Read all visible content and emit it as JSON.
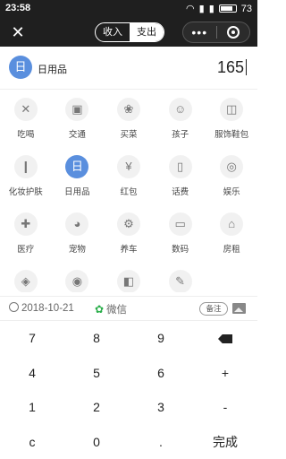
{
  "status_bar": {
    "time": "23:58",
    "battery": "73"
  },
  "top_bar": {
    "close_glyph": "✕",
    "tab_income": "收入",
    "tab_expense": "支出",
    "more_glyph": "•••"
  },
  "selected": {
    "icon": "日",
    "name": "日用品",
    "amount": "165"
  },
  "categories": [
    {
      "label": "吃喝",
      "icon": "utensils-icon",
      "glyph": "✕"
    },
    {
      "label": "交通",
      "icon": "bus-icon",
      "glyph": "▣"
    },
    {
      "label": "买菜",
      "icon": "vegetable-icon",
      "glyph": "❀"
    },
    {
      "label": "孩子",
      "icon": "baby-icon",
      "glyph": "☺"
    },
    {
      "label": "服饰鞋包",
      "icon": "shirt-icon",
      "glyph": "◫"
    },
    {
      "label": "化妆护肤",
      "icon": "lipstick-icon",
      "glyph": "❙"
    },
    {
      "label": "日用品",
      "icon": "daily-goods-icon",
      "glyph": "日"
    },
    {
      "label": "红包",
      "icon": "red-packet-icon",
      "glyph": "¥"
    },
    {
      "label": "话费",
      "icon": "phone-icon",
      "glyph": "▯"
    },
    {
      "label": "娱乐",
      "icon": "gamepad-icon",
      "glyph": "◎"
    },
    {
      "label": "医疗",
      "icon": "medical-icon",
      "glyph": "✚"
    },
    {
      "label": "宠物",
      "icon": "pet-icon",
      "glyph": "◕"
    },
    {
      "label": "养车",
      "icon": "car-icon",
      "glyph": "⚙"
    },
    {
      "label": "数码",
      "icon": "monitor-icon",
      "glyph": "▭"
    },
    {
      "label": "房租",
      "icon": "house-icon",
      "glyph": "⌂"
    },
    {
      "label": "",
      "icon": "fire-icon",
      "glyph": "◈"
    },
    {
      "label": "",
      "icon": "apple-icon",
      "glyph": "◉"
    },
    {
      "label": "",
      "icon": "basket-icon",
      "glyph": "◧"
    },
    {
      "label": "",
      "icon": "pencil-icon",
      "glyph": "✎"
    }
  ],
  "info_bar": {
    "date": "2018-10-21",
    "pay_method": "微信",
    "wechat_glyph": "✿",
    "note_label": "备注"
  },
  "keypad": [
    "7",
    "8",
    "9",
    "⌫",
    "4",
    "5",
    "6",
    "+",
    "1",
    "2",
    "3",
    "-",
    "c",
    "0",
    ".",
    "完成"
  ],
  "colors": {
    "accent": "#5a8fde",
    "wechat": "#2aae4a",
    "bar": "#1f1f1f"
  }
}
